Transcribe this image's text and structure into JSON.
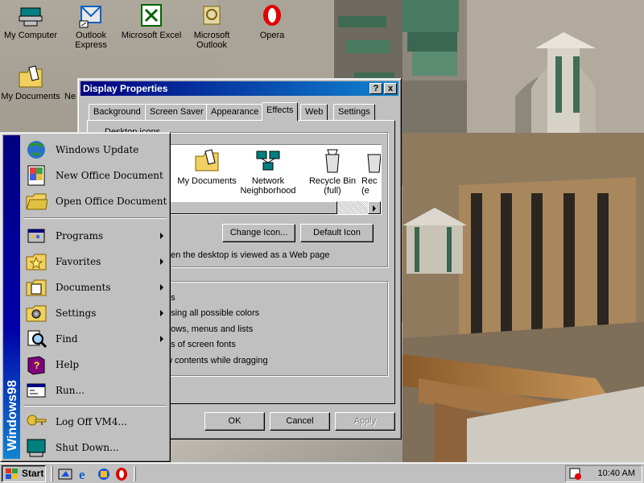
{
  "desktop": {
    "icons": [
      {
        "label": "My Computer",
        "icon": "my-computer-icon"
      },
      {
        "label": "Outlook Express",
        "icon": "outlook-express-icon"
      },
      {
        "label": "Microsoft Excel",
        "icon": "excel-icon"
      },
      {
        "label": "Microsoft Outlook",
        "icon": "outlook-icon"
      },
      {
        "label": "Opera",
        "icon": "opera-icon"
      },
      {
        "label": "My Documents",
        "icon": "my-documents-icon"
      },
      {
        "label": "Ne",
        "icon": "network-icon"
      }
    ]
  },
  "dialog": {
    "title": "Display Properties",
    "help_btn": "?",
    "close_btn": "x",
    "tabs": [
      "Background",
      "Screen Saver",
      "Appearance",
      "Effects",
      "Web",
      "Settings"
    ],
    "active_tab": "Effects",
    "desktop_icons_group": "Desktop icons",
    "icon_list": [
      {
        "label": "My Documents",
        "icon": "my-documents-icon"
      },
      {
        "label": "Network Neighborhood",
        "icon": "network-neighborhood-icon"
      },
      {
        "label": "Recycle Bin (full)",
        "icon": "recycle-bin-icon"
      },
      {
        "label": "Rec (e",
        "icon": "recycle-bin-icon"
      }
    ],
    "change_icon_btn": "Change Icon...",
    "default_icon_btn": "Default Icon",
    "hide_icons_text": "hen the desktop is viewed as a Web page",
    "effects_options": [
      "ns",
      "using all possible colors",
      "dows, menus and lists",
      "es of screen fonts",
      "w contents while dragging"
    ],
    "ok_btn": "OK",
    "cancel_btn": "Cancel",
    "apply_btn": "Apply"
  },
  "start_menu": {
    "banner_text": "Windows98",
    "top_items": [
      {
        "label": "Windows Update",
        "icon": "windows-update-icon"
      },
      {
        "label": "New Office Document",
        "icon": "new-office-document-icon"
      },
      {
        "label": "Open Office Document",
        "icon": "open-office-document-icon"
      }
    ],
    "main_items": [
      {
        "label": "Programs",
        "icon": "programs-icon",
        "submenu": true
      },
      {
        "label": "Favorites",
        "icon": "favorites-icon",
        "submenu": true
      },
      {
        "label": "Documents",
        "icon": "documents-icon",
        "submenu": true
      },
      {
        "label": "Settings",
        "icon": "settings-icon",
        "submenu": true
      },
      {
        "label": "Find",
        "icon": "find-icon",
        "submenu": true
      },
      {
        "label": "Help",
        "icon": "help-icon",
        "submenu": false
      },
      {
        "label": "Run...",
        "icon": "run-icon",
        "submenu": false
      }
    ],
    "bottom_items": [
      {
        "label": "Log Off VM4...",
        "icon": "log-off-icon"
      },
      {
        "label": "Shut Down...",
        "icon": "shut-down-icon"
      }
    ]
  },
  "taskbar": {
    "start_label": "Start",
    "quick_launch": [
      "show-desktop-icon",
      "internet-explorer-icon",
      "channels-icon",
      "opera-icon"
    ],
    "clock": "10:40 AM",
    "tray_icon": "scheduler-icon"
  }
}
